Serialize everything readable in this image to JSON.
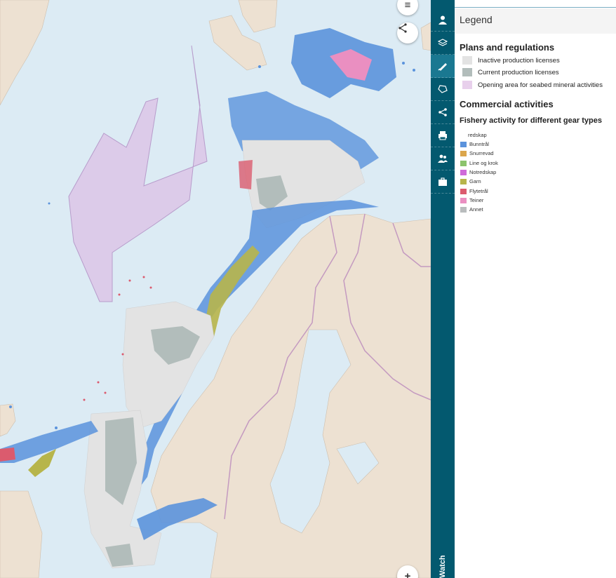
{
  "map": {
    "colors": {
      "sea": "#dcebf4",
      "land": "#ede1d2",
      "border": "#c49ac0",
      "seabed_area": "#dccbe9",
      "fishing_blue": "#5b93dc"
    }
  },
  "map_controls": {
    "menu_icon": "≡",
    "share_icon": "share-icon",
    "zoom_icon": "+"
  },
  "toolbar": {
    "tools": [
      {
        "name": "user-icon"
      },
      {
        "name": "layers-icon"
      },
      {
        "name": "legend-icon"
      },
      {
        "name": "draw-polygon-icon"
      },
      {
        "name": "share-icon"
      },
      {
        "name": "print-icon"
      },
      {
        "name": "users-icon"
      },
      {
        "name": "briefcase-icon"
      }
    ],
    "brand": "Watch",
    "colors": {
      "background": "#03596f",
      "active": "#1a7891"
    }
  },
  "legend": {
    "title": "Legend",
    "plans": {
      "title": "Plans and regulations",
      "items": [
        {
          "label": "Inactive production licenses",
          "color": "#e3e3e3"
        },
        {
          "label": "Current production licenses",
          "color": "#b2bdbb"
        },
        {
          "label": "Opening area for seabed mineral activities",
          "color": "#e8d0ec"
        }
      ]
    },
    "commercial": {
      "title": "Commercial activities",
      "subtitle": "Fishery activity for different gear types",
      "group_label": "redskap",
      "gear": [
        {
          "label": "Bunntrål",
          "color": "#5b93dc"
        },
        {
          "label": "Snurrevad",
          "color": "#dba64b"
        },
        {
          "label": "Line og krok",
          "color": "#8cc36c"
        },
        {
          "label": "Notredskap",
          "color": "#cf6ad9"
        },
        {
          "label": "Garn",
          "color": "#b7b54b"
        },
        {
          "label": "Flytetrål",
          "color": "#db5b6e"
        },
        {
          "label": "Teiner",
          "color": "#ea8fc1"
        },
        {
          "label": "Annet",
          "color": "#b9bcbd"
        }
      ]
    }
  }
}
